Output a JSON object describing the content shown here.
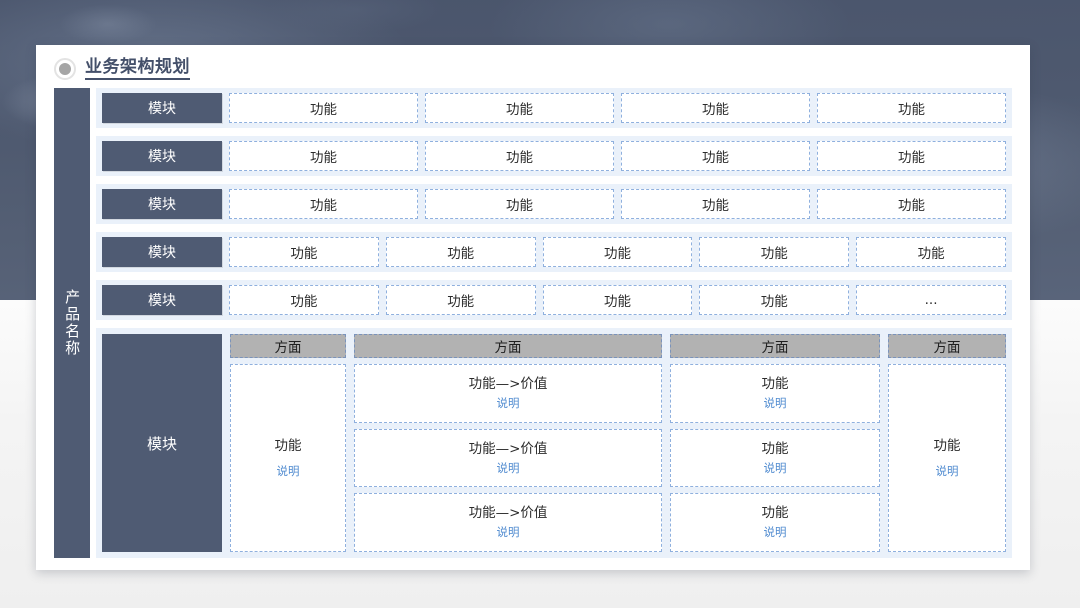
{
  "slide": {
    "title": "业务架构规划",
    "bullet_icon": "filled-circle-icon",
    "side_label": "产品名称"
  },
  "module_rows": [
    {
      "module": "模块",
      "cells": [
        "功能",
        "功能",
        "功能",
        "功能"
      ]
    },
    {
      "module": "模块",
      "cells": [
        "功能",
        "功能",
        "功能",
        "功能"
      ]
    },
    {
      "module": "模块",
      "cells": [
        "功能",
        "功能",
        "功能",
        "功能"
      ]
    },
    {
      "module": "模块",
      "cells": [
        "功能",
        "功能",
        "功能",
        "功能",
        "功能"
      ]
    },
    {
      "module": "模块",
      "cells": [
        "功能",
        "功能",
        "功能",
        "功能",
        "..."
      ]
    }
  ],
  "bottom_block": {
    "module": "模块",
    "columns": [
      {
        "aspect": "方面",
        "cells": [
          {
            "title": "功能",
            "note": "说明"
          }
        ]
      },
      {
        "aspect": "方面",
        "cells": [
          {
            "title": "功能—>价值",
            "note": "说明"
          },
          {
            "title": "功能—>价值",
            "note": "说明"
          },
          {
            "title": "功能—>价值",
            "note": "说明"
          }
        ]
      },
      {
        "aspect": "方面",
        "cells": [
          {
            "title": "功能",
            "note": "说明"
          },
          {
            "title": "功能",
            "note": "说明"
          },
          {
            "title": "功能",
            "note": "说明"
          }
        ]
      },
      {
        "aspect": "方面",
        "cells": [
          {
            "title": "功能",
            "note": "说明"
          }
        ]
      }
    ]
  },
  "colors": {
    "dark_slate": "#4f5b73",
    "row_bg": "#eaf1fa",
    "dashed_border": "#8fb0de",
    "aspect_gray": "#b2b2b2",
    "note_blue": "#4d89cf",
    "title_color": "#44506a",
    "card_bg": "#ffffff"
  }
}
